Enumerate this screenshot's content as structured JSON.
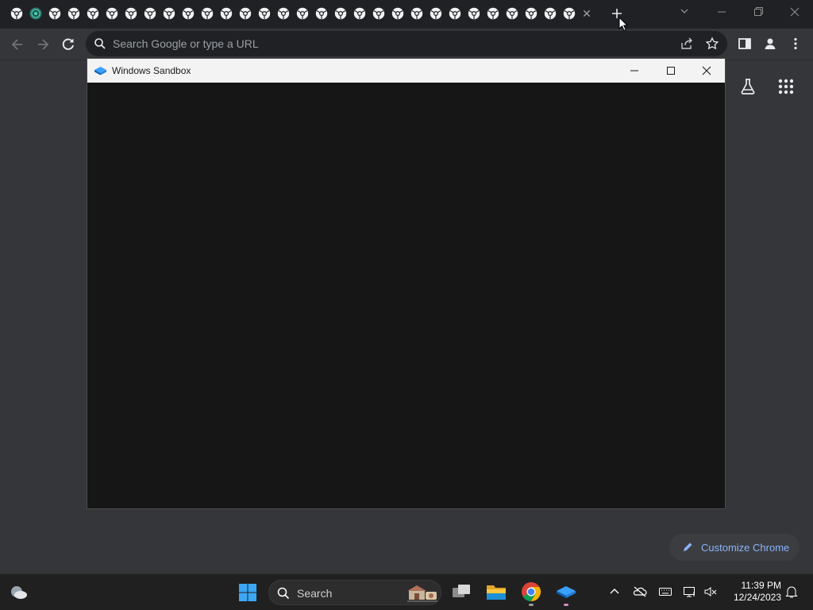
{
  "browser": {
    "tab_count": 30,
    "omnibox_placeholder": "Search Google or type a URL",
    "customize_label": "Customize Chrome"
  },
  "sandbox": {
    "title": "Windows Sandbox"
  },
  "taskbar": {
    "search_label": "Search",
    "time": "11:39 PM",
    "date": "12/24/2023"
  },
  "colors": {
    "browser_frame": "#202124",
    "browser_toolbar": "#35363a",
    "sandbox_content": "#161616",
    "accent_blue": "#8ab4f8",
    "taskbar": "#202020"
  },
  "icons": [
    "chrome-tab-icon",
    "new-tab-icon",
    "back-icon",
    "forward-icon",
    "reload-icon",
    "search-icon",
    "share-icon",
    "bookmark-star-icon",
    "side-panel-icon",
    "profile-icon",
    "menu-icon",
    "labs-icon",
    "apps-grid-icon",
    "pencil-icon",
    "sandbox-logo-icon",
    "minimize-icon",
    "maximize-icon",
    "close-icon",
    "weather-icon",
    "windows-start-icon",
    "task-view-icon",
    "file-explorer-icon",
    "chrome-app-icon",
    "sandbox-app-icon",
    "chevron-up-icon",
    "onedrive-icon",
    "keyboard-icon",
    "network-icon",
    "volume-muted-icon",
    "bell-icon"
  ]
}
